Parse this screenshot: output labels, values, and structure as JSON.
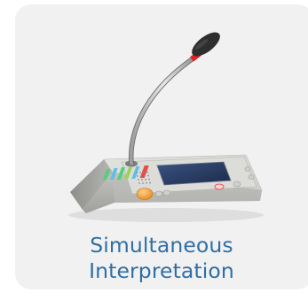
{
  "card": {
    "title_line1": "Simultaneous",
    "title_line2": "Interpretation",
    "title_color": "#2f6fa6",
    "background_color": "#f1f1f1"
  },
  "product": {
    "icon": "conference-microphone-console-icon",
    "mic_tip_color": "#e52121",
    "screen_color": "#2b3f63",
    "button_accent_color": "#f0a23a"
  }
}
